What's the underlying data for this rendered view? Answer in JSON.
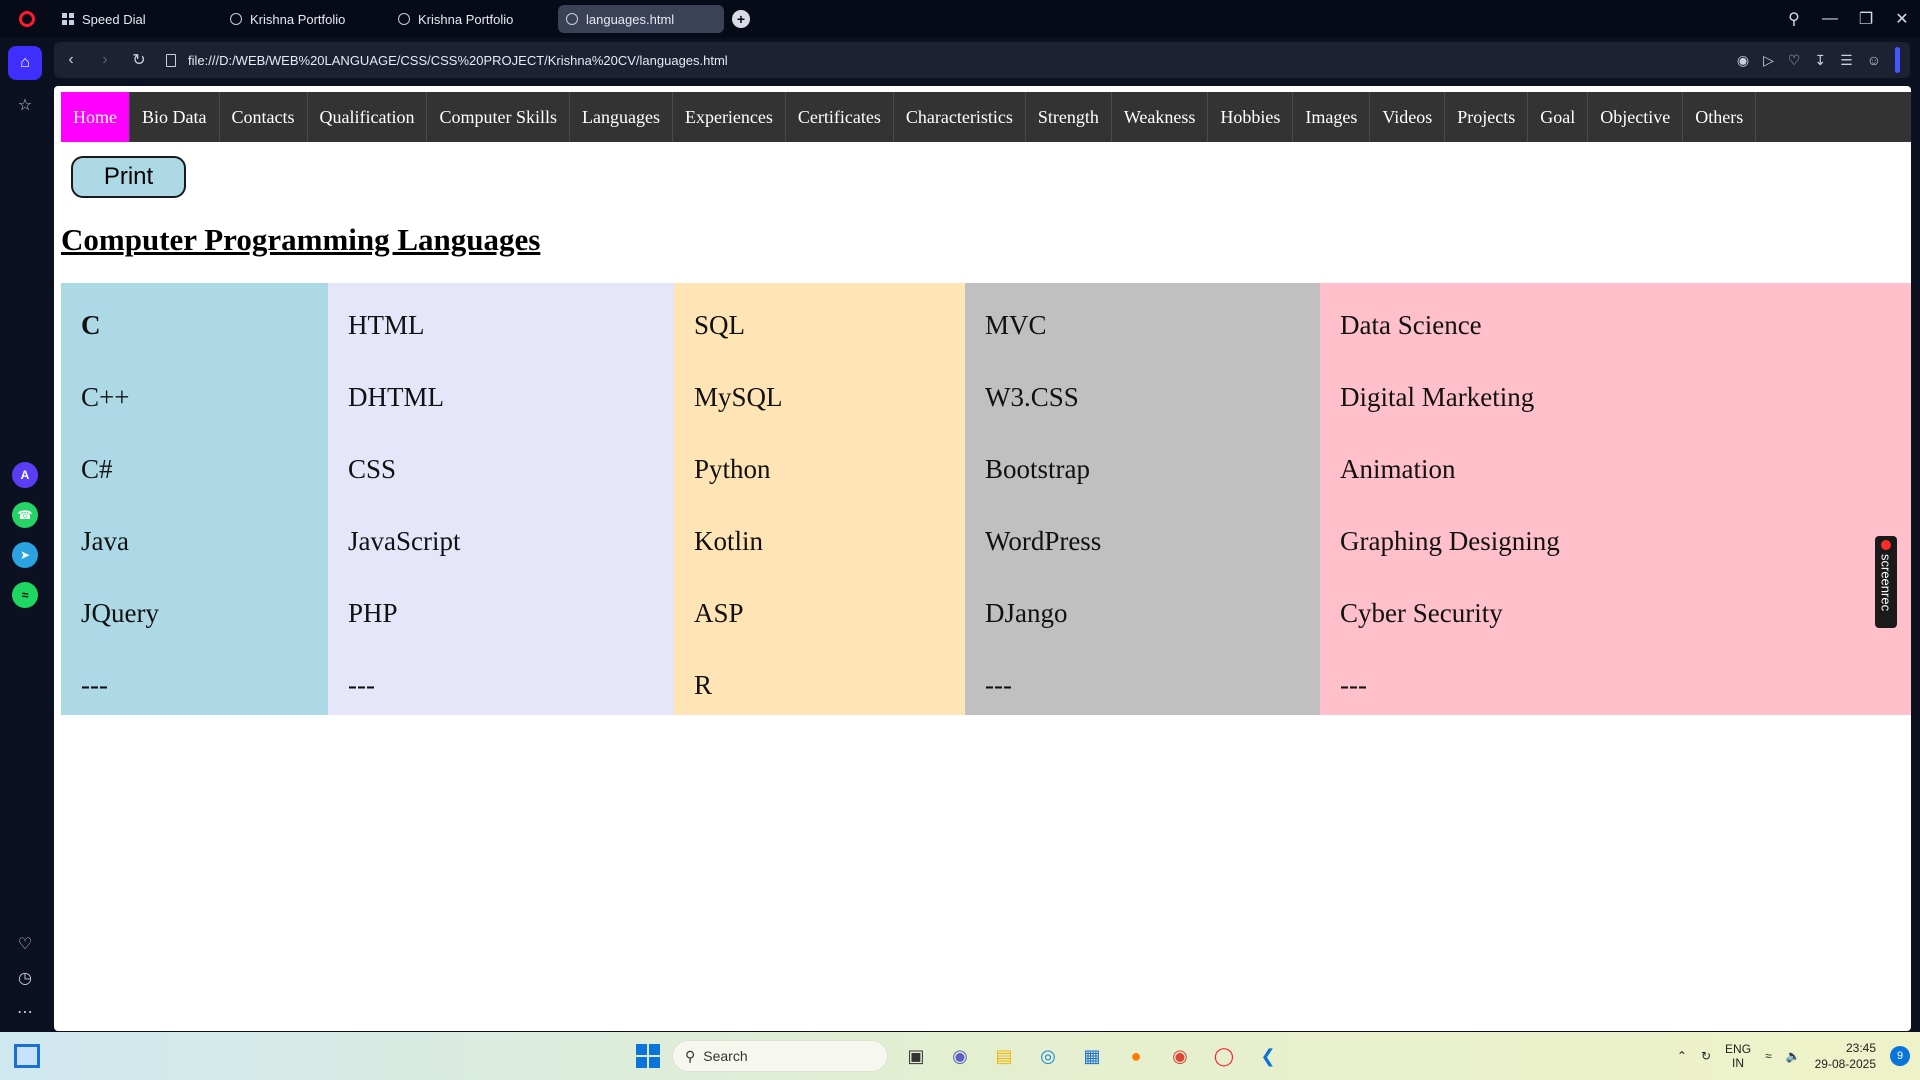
{
  "browser": {
    "tabs": [
      {
        "label": "Speed Dial",
        "icon": "grid-icon"
      },
      {
        "label": "Krishna Portfolio",
        "icon": "globe-icon"
      },
      {
        "label": "Krishna Portfolio",
        "icon": "globe-icon"
      },
      {
        "label": "languages.html",
        "icon": "globe-icon",
        "active": true
      }
    ],
    "new_tab": "+",
    "url": "file:///D:/WEB/WEB%20LANGUAGE/CSS/CSS%20PROJECT/Krishna%20CV/languages.html"
  },
  "menu": {
    "items": [
      "Home",
      "Bio Data",
      "Contacts",
      "Qualification",
      "Computer Skills",
      "Languages",
      "Experiences",
      "Certificates",
      "Characteristics",
      "Strength",
      "Weakness",
      "Hobbies",
      "Images",
      "Videos",
      "Projects",
      "Goal",
      "Objective",
      "Others"
    ],
    "active_color": "#ff00ff",
    "bar_color": "#333333"
  },
  "print_label": "Print",
  "heading": "Computer Programming Languages",
  "table": {
    "columns": [
      {
        "color": "#add8e6",
        "items": [
          "C",
          "C++",
          "C#",
          "Java",
          "JQuery",
          "---"
        ]
      },
      {
        "color": "#e6e6fa",
        "items": [
          "HTML",
          "DHTML",
          "CSS",
          "JavaScript",
          "PHP",
          "---"
        ]
      },
      {
        "color": "#ffe4b5",
        "items": [
          "SQL",
          "MySQL",
          "Python",
          "Kotlin",
          "ASP",
          "R"
        ]
      },
      {
        "color": "#c0c0c0",
        "items": [
          "MVC",
          "W3.CSS",
          "Bootstrap",
          "WordPress",
          "DJango",
          "---"
        ]
      },
      {
        "color": "#ffc0cb",
        "items": [
          "Data Science",
          "Digital Marketing",
          "Animation",
          "Graphing Designing",
          "Cyber Security",
          "---"
        ]
      }
    ]
  },
  "screenrec_label": "screenrec",
  "taskbar": {
    "search_placeholder": "Search",
    "lang_line1": "ENG",
    "lang_line2": "IN",
    "time": "23:45",
    "date": "29-08-2025",
    "notifications": "9"
  }
}
